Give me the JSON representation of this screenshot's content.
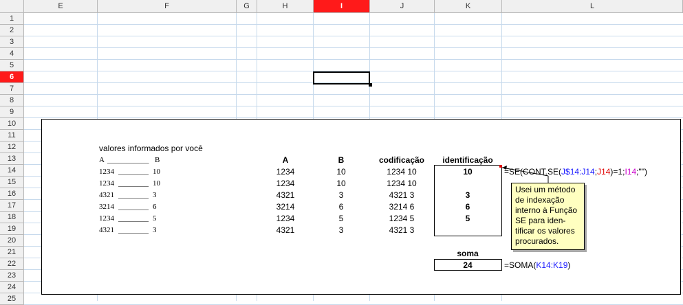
{
  "columns": [
    "E",
    "F",
    "G",
    "H",
    "I",
    "J",
    "K",
    "L"
  ],
  "selected_column": "I",
  "rows": [
    "1",
    "2",
    "3",
    "4",
    "5",
    "6",
    "7",
    "8",
    "9",
    "10",
    "11",
    "12",
    "13",
    "14",
    "15",
    "16",
    "17",
    "18",
    "19",
    "20",
    "21",
    "22",
    "23",
    "24",
    "25"
  ],
  "selected_row": "6",
  "sheet": {
    "subtitle": "valores informados por você",
    "input_header_a": "A",
    "input_header_b": "B",
    "input_rows": [
      {
        "a": "1234",
        "b": "10"
      },
      {
        "a": "1234",
        "b": "10"
      },
      {
        "a": "4321",
        "b": "3"
      },
      {
        "a": "3214",
        "b": "6"
      },
      {
        "a": "1234",
        "b": "5"
      },
      {
        "a": "4321",
        "b": "3"
      }
    ],
    "headers": {
      "a": "A",
      "b": "B",
      "codificacao": "codificação",
      "identificacao": "identificação"
    },
    "table_rows": [
      {
        "a": "1234",
        "b": "10",
        "cod": "1234 10",
        "ident": "10"
      },
      {
        "a": "1234",
        "b": "10",
        "cod": "1234 10",
        "ident": ""
      },
      {
        "a": "4321",
        "b": "3",
        "cod": "4321 3",
        "ident": "3"
      },
      {
        "a": "3214",
        "b": "6",
        "cod": "3214 6",
        "ident": "6"
      },
      {
        "a": "1234",
        "b": "5",
        "cod": "1234 5",
        "ident": "5"
      },
      {
        "a": "4321",
        "b": "3",
        "cod": "4321 3",
        "ident": ""
      }
    ],
    "soma_label": "soma",
    "soma_value": "24",
    "formula_se": {
      "p1": "=SE(CONT.SE(",
      "r1": "J$14:J14",
      "p2": ";",
      "r2": "J14",
      "p3": ")=1;",
      "r3": "I14",
      "p4": ";\"\")"
    },
    "formula_soma": {
      "p1": "=SOMA(",
      "r1": "K14:K19",
      "p2": ")"
    },
    "comment_lines": [
      "Usei um método",
      "de indexação",
      "interno à Função",
      "SE para iden-",
      "tificar os valores",
      "procurados."
    ]
  },
  "colors": {
    "selected_header": "#ff1a1a",
    "gridline": "#c6d9ec",
    "comment_bg": "#ffffc0"
  }
}
